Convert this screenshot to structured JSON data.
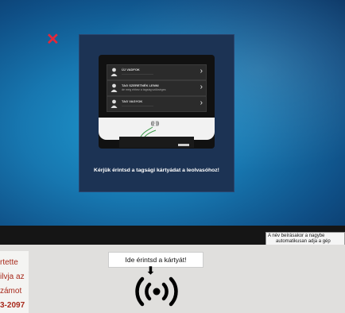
{
  "screen": {
    "close_icon": "close-icon",
    "menu": [
      {
        "title": "ÚJ VADFOK",
        "desc": "........................................"
      },
      {
        "title": "TAG SZERETNÉK LENNI",
        "desc": "de még ehhez a tagság szükséges"
      },
      {
        "title": "TAG VAGYOK",
        "desc": "........................................"
      }
    ],
    "reader_symbol": "((·))",
    "prompt": "Kérjük érintsd a tagsági kártyádat a leolvasóhoz!"
  },
  "notice": {
    "line1": "A név beírásakor  a nagybe",
    "line2": "automatikusan adja a gép"
  },
  "sticker": {
    "red_lines": [
      "rtette",
      "ilvja az",
      "zámot",
      "3-2097"
    ],
    "tap_label": "Ide érintsd a kártyát!",
    "arrow": "⬇"
  },
  "colors": {
    "screen_blue": "#1777b0",
    "overlay_navy": "#1c3354",
    "close_red": "#e4283a",
    "sticker_red": "#a82a1c"
  }
}
